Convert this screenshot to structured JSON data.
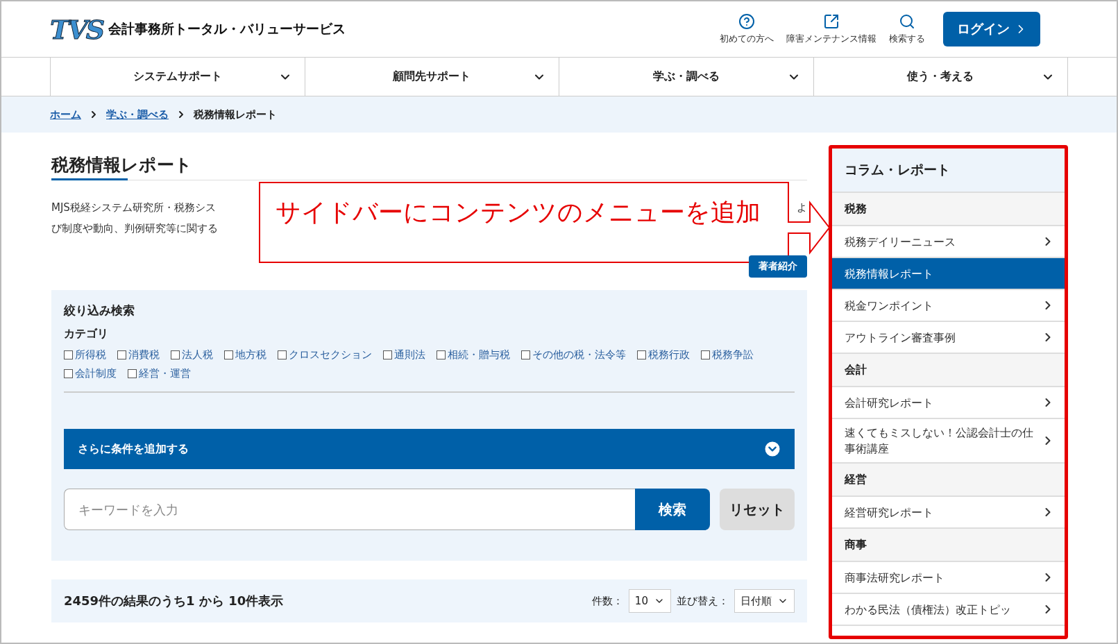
{
  "header": {
    "logo_mark": "TVS",
    "site_name": "会計事務所トータル・バリューサービス",
    "utility_links": [
      {
        "label": "初めての方へ"
      },
      {
        "label": "障害メンテナンス情報"
      },
      {
        "label": "検索する"
      }
    ],
    "login_button": "ログイン"
  },
  "nav": [
    {
      "label": "システムサポート"
    },
    {
      "label": "顧問先サポート"
    },
    {
      "label": "学ぶ・調べる"
    },
    {
      "label": "使う・考える"
    }
  ],
  "breadcrumb": [
    {
      "label": "ホーム",
      "kind": "link"
    },
    {
      "label": "学ぶ・調べる",
      "kind": "link"
    },
    {
      "label": "税務情報レポート",
      "kind": "current"
    }
  ],
  "page": {
    "title": "税務情報レポート",
    "description_lines": [
      {
        "left": "MJS税経システム研究所・税務シス",
        "right": "よ"
      },
      {
        "left": "び制度や動向、判例研究等に関する"
      }
    ],
    "author_button": "著者紹介"
  },
  "filter": {
    "title": "絞り込み検索",
    "category_label": "カテゴリ",
    "categories": [
      {
        "label": "所得税",
        "checked": false
      },
      {
        "label": "消費税",
        "checked": false
      },
      {
        "label": "法人税",
        "checked": false
      },
      {
        "label": "地方税",
        "checked": false
      },
      {
        "label": "クロスセクション",
        "checked": false
      },
      {
        "label": "通則法",
        "checked": false
      },
      {
        "label": "相続・贈与税",
        "checked": false
      },
      {
        "label": "その他の税・法令等",
        "checked": false
      },
      {
        "label": "税務行政",
        "checked": false
      },
      {
        "label": "税務争訟",
        "checked": false
      },
      {
        "label": "会計制度",
        "checked": false
      },
      {
        "label": "経営・運営",
        "checked": false
      }
    ],
    "more_conditions": "さらに条件を追加する",
    "expanded": false,
    "keyword_placeholder": "キーワードを入力",
    "search_button": "検索",
    "reset_button": "リセット"
  },
  "results": {
    "summary": "2459件の結果のうち1 から 10件表示",
    "per_page_label": "件数：",
    "per_page": "10",
    "sort_label": "並び替え：",
    "sort": "日付順"
  },
  "sidebar": {
    "title": "コラム・レポート",
    "items": [
      {
        "kind": "heading",
        "label": "税務"
      },
      {
        "kind": "link",
        "label": "税務デイリーニュース",
        "selected": false
      },
      {
        "kind": "link",
        "label": "税務情報レポート",
        "selected": true
      },
      {
        "kind": "link",
        "label": "税金ワンポイント",
        "selected": false
      },
      {
        "kind": "link",
        "label": "アウトライン審査事例",
        "selected": false
      },
      {
        "kind": "heading",
        "label": "会計"
      },
      {
        "kind": "link",
        "label": "会計研究レポート",
        "selected": false
      },
      {
        "kind": "link",
        "label": "速くてもミスしない！公認会計士の仕事術講座",
        "selected": false
      },
      {
        "kind": "heading",
        "label": "経営"
      },
      {
        "kind": "link",
        "label": "経営研究レポート",
        "selected": false
      },
      {
        "kind": "heading",
        "label": "商事"
      },
      {
        "kind": "link",
        "label": "商事法研究レポート",
        "selected": false
      },
      {
        "kind": "link",
        "label": "わかる民法（債権法）改正トピッ",
        "selected": false
      }
    ]
  },
  "annotation": {
    "text": "サイドバーにコンテンツのメニューを追加"
  }
}
